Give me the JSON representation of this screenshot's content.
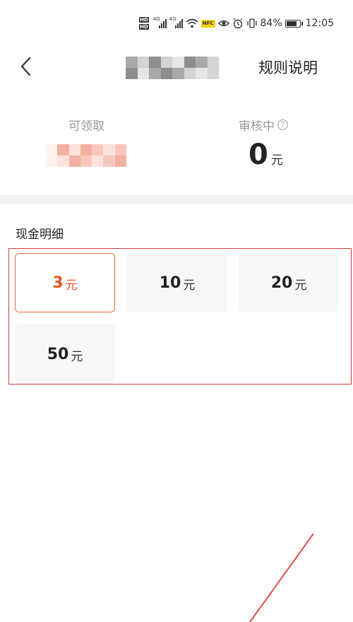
{
  "status_bar": {
    "battery_percent": "84%",
    "battery_level": 0.84,
    "time": "12:05",
    "network_1": "4G",
    "network_2": "4G",
    "hd_1": "HD",
    "hd_2": "HD",
    "nfc": "NFC"
  },
  "header": {
    "rules_label": "规则说明"
  },
  "summary": {
    "claimable_label": "可领取",
    "review_label": "审核中",
    "review_help_icon": "?",
    "review_amount": "0",
    "review_unit": "元"
  },
  "cash_detail": {
    "title": "现金明细",
    "options": [
      {
        "amount": "3",
        "unit": "元",
        "selected": true
      },
      {
        "amount": "10",
        "unit": "元",
        "selected": false
      },
      {
        "amount": "20",
        "unit": "元",
        "selected": false
      },
      {
        "amount": "50",
        "unit": "元",
        "selected": false
      }
    ]
  },
  "colors": {
    "accent": "#e8541e",
    "highlight_border": "#d93a3a",
    "card_bg": "#f7f7f7"
  }
}
